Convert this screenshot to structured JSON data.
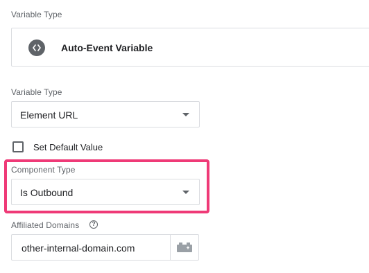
{
  "variable_type_section": {
    "label": "Variable Type",
    "selected_type": "Auto-Event Variable",
    "icon": "code-brackets-icon"
  },
  "variable_type_field": {
    "label": "Variable Type",
    "value": "Element URL"
  },
  "default_value": {
    "label": "Set Default Value",
    "checked": false
  },
  "component_type": {
    "label": "Component Type",
    "value": "Is Outbound",
    "highlight_color": "#ef3a77"
  },
  "affiliated_domains": {
    "label": "Affiliated Domains",
    "help_glyph": "?",
    "value": "other-internal-domain.com",
    "button_icon": "variable-lego-icon"
  }
}
